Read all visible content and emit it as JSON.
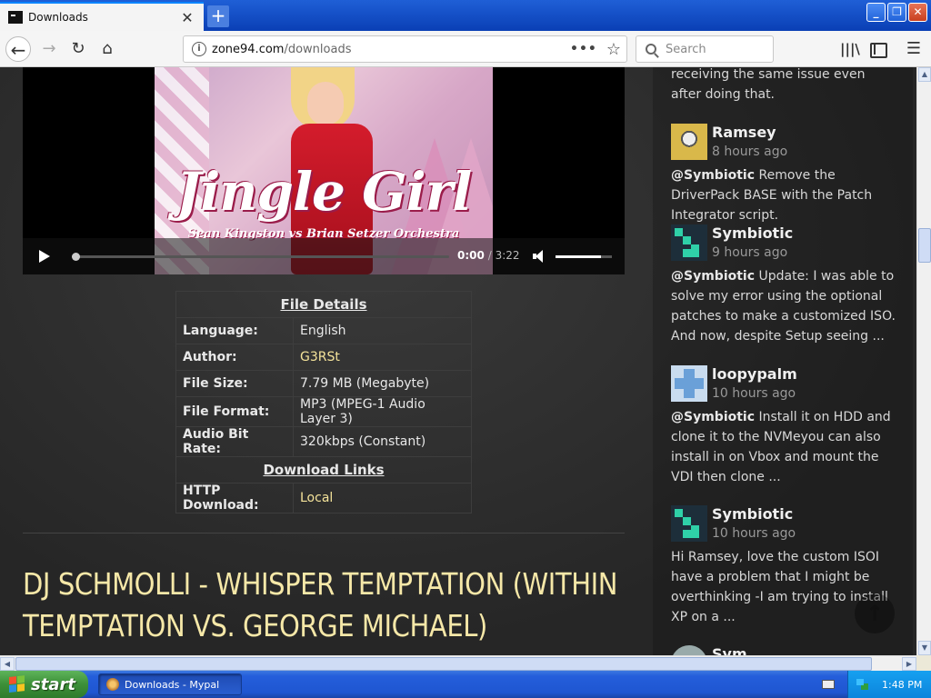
{
  "browser": {
    "tab_title": "Downloads",
    "tab_close": "✕",
    "new_tab": "+",
    "url_domain": "zone94.com",
    "url_path": "/downloads",
    "url_more": "•••",
    "search_placeholder": "Search",
    "window_buttons": [
      "_",
      "❐",
      "✕"
    ]
  },
  "player": {
    "album_title": "Jingle Girl",
    "album_subtitle": "Sean Kingston vs Brian Setzer Orchestra",
    "time_current": "0:00",
    "time_separator": "/",
    "time_duration": "3:22",
    "progress": 0,
    "volume": 0.8
  },
  "file_details": {
    "header": "File Details",
    "rows": [
      {
        "key": "Language:",
        "value": "English"
      },
      {
        "key": "Author:",
        "value": "G3RSt"
      },
      {
        "key": "File Size:",
        "value": "7.79 MB (Megabyte)"
      },
      {
        "key": "File Format:",
        "value": "MP3 (MPEG-1 Audio Layer 3)"
      },
      {
        "key": "Audio Bit Rate:",
        "value": "320kbps (Constant)"
      }
    ],
    "links_header": "Download Links",
    "link_key": "HTTP Download:",
    "link_value": "Local"
  },
  "post_title": "DJ SCHMOLLI - WHISPER TEMPTATION (WITHIN TEMPTATION VS. GEORGE MICHAEL)",
  "comments": {
    "top_fragment": "receiving the same issue even after doing that.",
    "items": [
      {
        "name": "Ramsey",
        "time": "8 hours ago",
        "mention": "@Symbiotic",
        "text": " Remove the DriverPack BASE with the Patch Integrator script."
      },
      {
        "name": "Symbiotic",
        "time": "9 hours ago",
        "mention": "@Symbiotic",
        "text": " Update: I was able to solve my error using the optional patches to make a customized ISO. And now, despite Setup seeing ..."
      },
      {
        "name": "loopypalm",
        "time": "10 hours ago",
        "mention": "@Symbiotic",
        "text": " Install it on HDD and clone it to the NVMeyou can also install in on Vbox and mount the VDI then clone ..."
      },
      {
        "name": "Symbiotic",
        "time": "10 hours ago",
        "mention": "",
        "text": "Hi Ramsey, love the custom ISOI have a problem that I might be overthinking -I am trying to install XP on a ..."
      },
      {
        "name": "Sym",
        "time": "",
        "mention": "",
        "text": ""
      }
    ],
    "scroll_top": "↑"
  },
  "taskbar": {
    "start_label": "start",
    "task_label": "Downloads - Mypal",
    "clock": "1:48 PM"
  }
}
